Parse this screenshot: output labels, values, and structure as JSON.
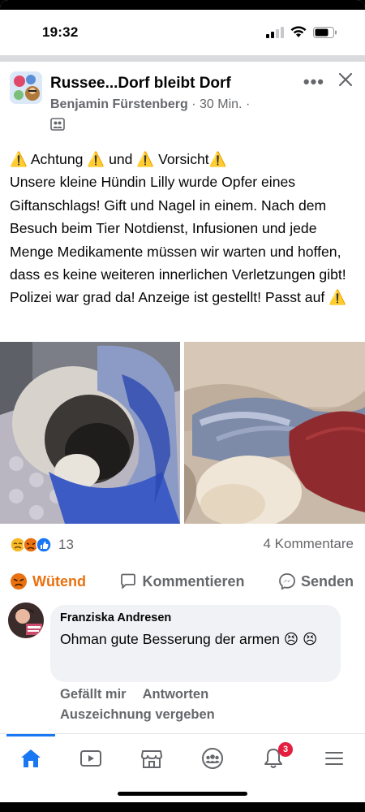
{
  "status_bar": {
    "time": "19:32"
  },
  "post": {
    "group_name": "Russee...Dorf bleibt Dorf",
    "author": "Benjamin Fürstenberg",
    "separator": " · ",
    "time_ago": "30 Min.",
    "trailing_dot": " ·",
    "text": "⚠️ Achtung ⚠️ und ⚠️ Vorsicht⚠️\nUnsere kleine Hündin Lilly wurde Opfer eines Giftanschlags! Gift und Nagel in einem. Nach dem Besuch beim Tier Notdienst, Infusionen und jede Menge Medikamente müssen wir warten und hoffen, dass es keine weiteren innerlichen Verletzungen gibt! Polizei war grad da! Anzeige ist gestellt! Passt auf ⚠️",
    "reaction_count": "13",
    "comments_count": "4 Kommentare"
  },
  "actions": {
    "react": "Wütend",
    "comment": "Kommentieren",
    "send": "Senden"
  },
  "comment": {
    "author": "Franziska Andresen",
    "text": "Ohman gute Besserung der armen 😣 😣",
    "like": "Gefällt mir",
    "reply": "Antworten",
    "award": "Auszeichnung vergeben"
  },
  "tabbar": {
    "notifications_badge": "3"
  },
  "icons": {
    "home": "home-icon",
    "watch": "video-icon",
    "marketplace": "marketplace-icon",
    "groups": "groups-icon",
    "notifications": "bell-icon",
    "menu": "menu-icon"
  },
  "colors": {
    "accent": "#1877f2",
    "angry": "#e9710f",
    "badge": "#e41e3f",
    "muted": "#65676b"
  }
}
